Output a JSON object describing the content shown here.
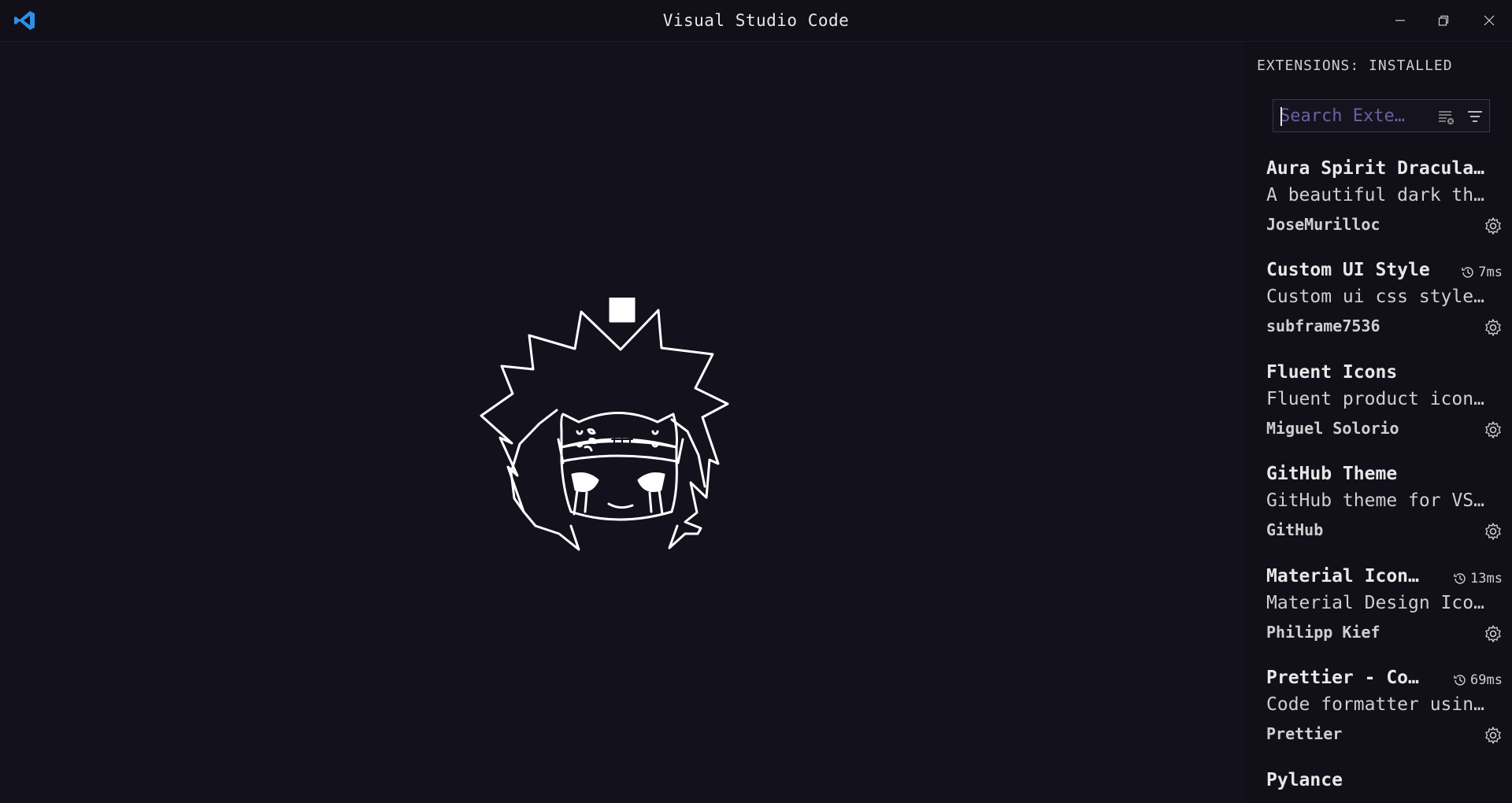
{
  "window": {
    "title": "Visual Studio Code"
  },
  "icons": {
    "app": "vscode-logo-icon",
    "minimize": "minimize-icon",
    "restore": "restore-icon",
    "close": "close-icon"
  },
  "sidebar": {
    "title": "EXTENSIONS: INSTALLED",
    "search": {
      "placeholder": "Search Exte…"
    },
    "extensions": [
      {
        "name": "Aura Spirit Dracula…",
        "description": "A beautiful dark th…",
        "publisher": "JoseMurilloc",
        "time": ""
      },
      {
        "name": "Custom UI Style",
        "description": "Custom ui css style…",
        "publisher": "subframe7536",
        "time": "7ms"
      },
      {
        "name": "Fluent Icons",
        "description": "Fluent product icon…",
        "publisher": "Miguel Solorio",
        "time": ""
      },
      {
        "name": "GitHub Theme",
        "description": "GitHub theme for VS…",
        "publisher": "GitHub",
        "time": ""
      },
      {
        "name": "Material Icon…",
        "description": "Material Design Ico…",
        "publisher": "Philipp Kief",
        "time": "13ms"
      },
      {
        "name": "Prettier - Co…",
        "description": "Code formatter usin…",
        "publisher": "Prettier",
        "time": "69ms"
      },
      {
        "name": "Pylance",
        "description": "",
        "publisher": "",
        "time": ""
      }
    ]
  },
  "colors": {
    "background": "#13111c",
    "accent": "#6f5fa0",
    "vscode_blue": "#2f8fe5"
  }
}
